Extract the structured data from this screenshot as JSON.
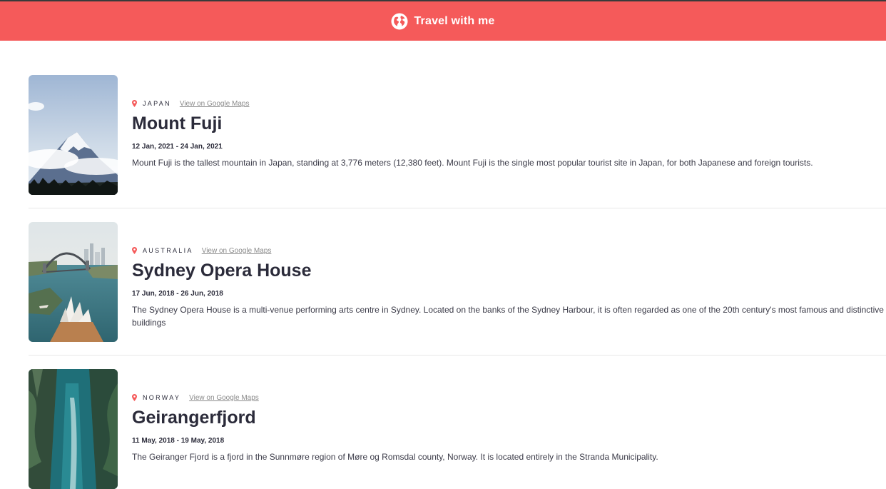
{
  "header": {
    "title": "Travel with me",
    "icon": "globe-icon",
    "background_color": "#f55a5a"
  },
  "accent_color": "#f55a5a",
  "entries": [
    {
      "country": "JAPAN",
      "maps_link": "View on Google Maps",
      "title": "Mount Fuji",
      "dates": "12 Jan, 2021 - 24 Jan, 2021",
      "description": "Mount Fuji is the tallest mountain in Japan, standing at 3,776 meters (12,380 feet). Mount Fuji is the single most popular tourist site in Japan, for both Japanese and foreign tourists."
    },
    {
      "country": "AUSTRALIA",
      "maps_link": "View on Google Maps",
      "title": "Sydney Opera House",
      "dates": "17 Jun, 2018 - 26 Jun, 2018",
      "description": "The Sydney Opera House is a multi-venue performing arts centre in Sydney. Located on the banks of the Sydney Harbour, it is often regarded as one of the 20th century's most famous and distinctive buildings"
    },
    {
      "country": "NORWAY",
      "maps_link": "View on Google Maps",
      "title": "Geirangerfjord",
      "dates": "11 May, 2018 - 19 May, 2018",
      "description": "The Geiranger Fjord is a fjord in the Sunnmøre region of Møre og Romsdal county, Norway. It is located entirely in the Stranda Municipality."
    }
  ]
}
